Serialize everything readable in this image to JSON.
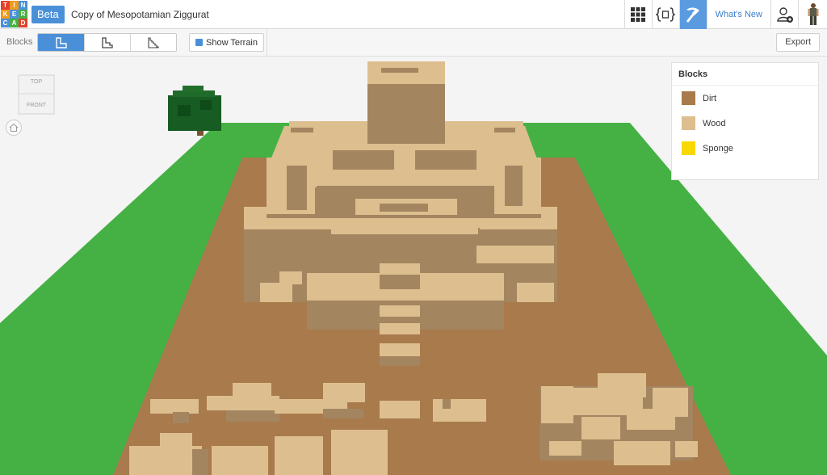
{
  "app": {
    "logo_letters": [
      "T",
      "I",
      "N",
      "K",
      "E",
      "R",
      "C",
      "A",
      "D"
    ],
    "beta_label": "Beta",
    "title": "Copy of Mesopotamian Ziggurat",
    "whats_new": "What's New"
  },
  "toolbar": {
    "blocks_label": "Blocks",
    "show_terrain_label": "Show Terrain",
    "show_terrain_checked": true,
    "export_label": "Export"
  },
  "viewcube": {
    "top": "TOP",
    "front": "FRONT"
  },
  "legend": {
    "title": "Blocks",
    "items": [
      {
        "label": "Dirt",
        "color": "#a87a4c"
      },
      {
        "label": "Wood",
        "color": "#ddbe8f"
      },
      {
        "label": "Sponge",
        "color": "#f7d800"
      }
    ]
  },
  "colors": {
    "grass": "#45b144",
    "dirt": "#a87a4c",
    "wood_top": "#ddbe8f",
    "wood_side": "#a38660",
    "accent": "#4a90d9"
  }
}
